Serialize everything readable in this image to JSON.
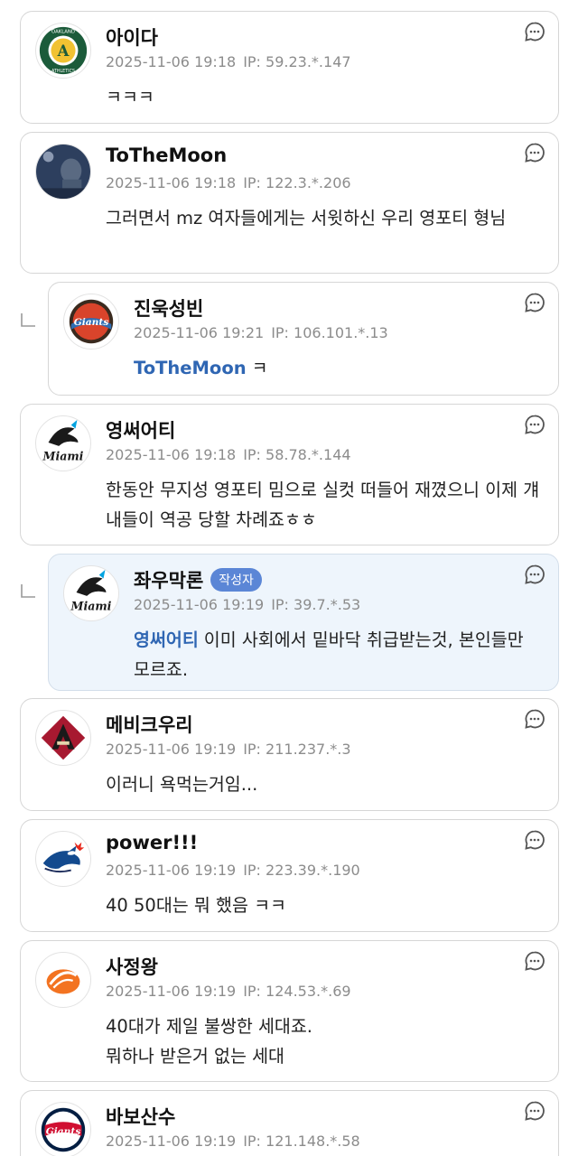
{
  "comments": [
    {
      "name": "아이다",
      "date": "2025-11-06 19:18",
      "ip": "IP: 59.23.*.147",
      "body": "ㅋㅋㅋ",
      "avatar_icon": "oakland-athletics-logo"
    },
    {
      "name": "ToTheMoon",
      "date": "2025-11-06 19:18",
      "ip": "IP: 122.3.*.206",
      "body": "그러면서 mz 여자들에게는 서윗하신 우리 영포티 형님",
      "avatar_icon": "night-photo-avatar"
    },
    {
      "name": "진욱성빈",
      "date": "2025-11-06 19:21",
      "ip": "IP: 106.101.*.13",
      "mention": "ToTheMoon",
      "body": "ㅋ",
      "avatar_icon": "giants-logo"
    },
    {
      "name": "영써어티",
      "date": "2025-11-06 19:18",
      "ip": "IP: 58.78.*.144",
      "body": "한동안 무지성 영포티 밈으로 실컷 떠들어 재꼈으니 이제 걔내들이 역공 당할 차례죠ㅎㅎ",
      "avatar_icon": "miami-marlins-logo"
    },
    {
      "name": "좌우막론",
      "badge": "작성자",
      "date": "2025-11-06 19:19",
      "ip": "IP: 39.7.*.53",
      "mention": "영써어티",
      "body": "이미 사회에서 밑바닥 취급받는것, 본인들만 모르죠.",
      "avatar_icon": "miami-marlins-logo"
    },
    {
      "name": "메비크우리",
      "date": "2025-11-06 19:19",
      "ip": "IP: 211.237.*.3",
      "body": "이러니 욕먹는거임...",
      "avatar_icon": "arizona-diamondbacks-logo"
    },
    {
      "name": "power!!!",
      "date": "2025-11-06 19:19",
      "ip": "IP: 223.39.*.190",
      "body": "40 50대는 뭐 했음 ㅋㅋ",
      "avatar_icon": "toronto-blue-jays-logo"
    },
    {
      "name": "사정왕",
      "date": "2025-11-06 19:19",
      "ip": "IP: 124.53.*.69",
      "body_lines": [
        "40대가 제일 불쌍한 세대죠.",
        "뭐하나 받은거 없는 세대"
      ],
      "avatar_icon": "hanwha-eagles-logo"
    },
    {
      "name": "바보산수",
      "date": "2025-11-06 19:19",
      "ip": "IP: 121.148.*.58",
      "avatar_icon": "lotte-giants-logo"
    }
  ],
  "icons": {
    "reply": "reply-bubble-icon",
    "nested": "nested-reply-arrow-icon"
  },
  "colors": {
    "mention": "#2f66b3",
    "badge": "#5b86d6",
    "author_background": "#eef5fc",
    "meta": "#8c8c8c"
  }
}
